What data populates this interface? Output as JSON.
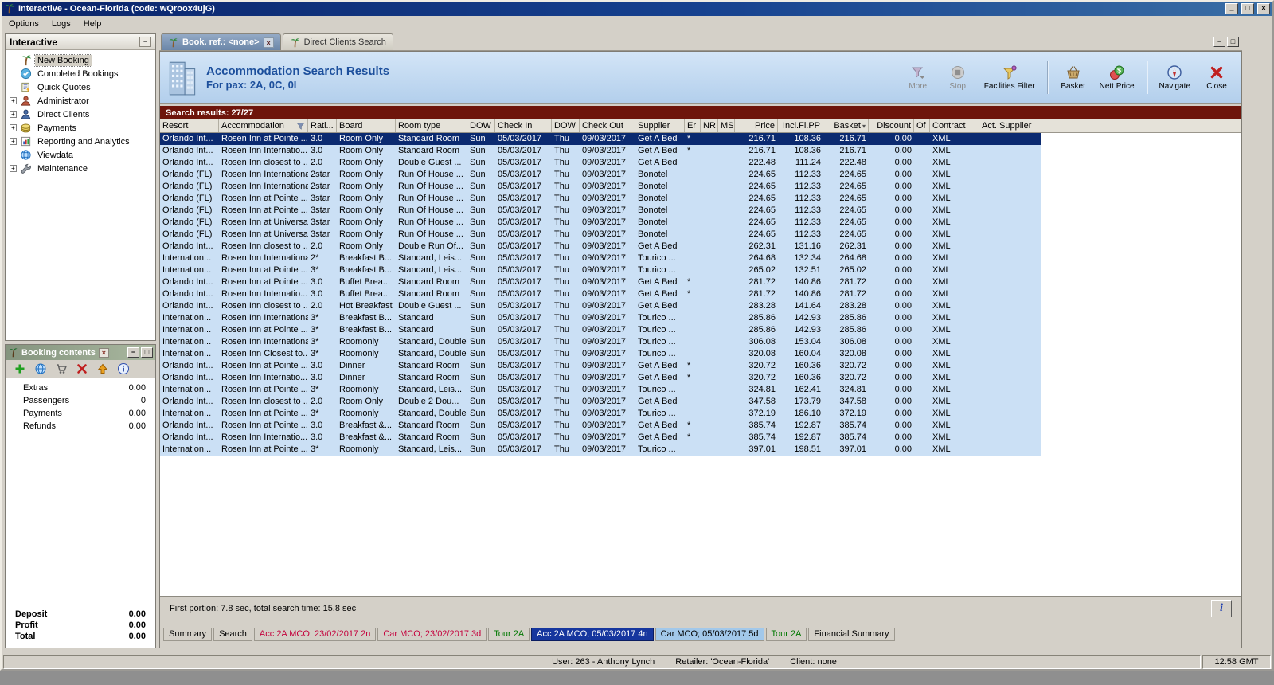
{
  "window": {
    "title": "Interactive - Ocean-Florida (code: wQroox4ujG)",
    "time": "12:58 GMT"
  },
  "icons": {
    "minimize": "_",
    "maximize": "□",
    "close": "×",
    "collapse": "−",
    "expand": "+",
    "tab_close": "×",
    "sort_desc": "▾",
    "info": "i",
    "panel_min": "−",
    "panel_restore": "□"
  },
  "menu": [
    "Options",
    "Logs",
    "Help"
  ],
  "sidebar": {
    "title": "Interactive",
    "items": [
      {
        "label": "New Booking",
        "icon": "new-booking-icon",
        "selected": true,
        "expandable": false
      },
      {
        "label": "Completed Bookings",
        "icon": "completed-bookings-icon",
        "selected": false,
        "expandable": false
      },
      {
        "label": "Quick Quotes",
        "icon": "quick-quotes-icon",
        "selected": false,
        "expandable": false
      },
      {
        "label": "Administrator",
        "icon": "administrator-icon",
        "selected": false,
        "expandable": true
      },
      {
        "label": "Direct Clients",
        "icon": "direct-clients-icon",
        "selected": false,
        "expandable": true
      },
      {
        "label": "Payments",
        "icon": "payments-icon",
        "selected": false,
        "expandable": true
      },
      {
        "label": "Reporting and Analytics",
        "icon": "reporting-icon",
        "selected": false,
        "expandable": true
      },
      {
        "label": "Viewdata",
        "icon": "viewdata-icon",
        "selected": false,
        "expandable": false
      },
      {
        "label": "Maintenance",
        "icon": "maintenance-icon",
        "selected": false,
        "expandable": true
      }
    ]
  },
  "booking_contents": {
    "title": "Booking contents",
    "toolbar_icons": [
      "add-icon",
      "world-icon",
      "basket-small-icon",
      "delete-icon",
      "upload-icon",
      "small-info-icon"
    ],
    "rows": [
      {
        "label": "Extras",
        "value": "0.00"
      },
      {
        "label": "Passengers",
        "value": "0"
      },
      {
        "label": "Payments",
        "value": "0.00"
      },
      {
        "label": "Refunds",
        "value": "0.00"
      }
    ],
    "totals": [
      {
        "label": "Deposit",
        "value": "0.00"
      },
      {
        "label": "Profit",
        "value": "0.00"
      },
      {
        "label": "Total",
        "value": "0.00"
      }
    ]
  },
  "mdi_tabs": [
    {
      "label": "Book. ref.: <none>",
      "active": true,
      "closable": true
    },
    {
      "label": "Direct Clients Search",
      "active": false,
      "closable": false
    }
  ],
  "header": {
    "title": "Accommodation Search Results",
    "subtitle": "For pax: 2A, 0C, 0I"
  },
  "toolbar": [
    {
      "label": "More",
      "icon": "more-icon",
      "disabled": true
    },
    {
      "label": "Stop",
      "icon": "stop-icon",
      "disabled": true
    },
    {
      "label": "Facilities Filter",
      "icon": "facilities-filter-icon",
      "disabled": false
    },
    {
      "separator": true
    },
    {
      "label": "Basket",
      "icon": "basket-icon",
      "disabled": false
    },
    {
      "label": "Nett Price",
      "icon": "nett-price-icon",
      "disabled": false
    },
    {
      "separator": true
    },
    {
      "label": "Navigate",
      "icon": "navigate-icon",
      "disabled": false
    },
    {
      "label": "Close",
      "icon": "close-icon",
      "disabled": false
    }
  ],
  "results_bar": "Search results: 27/27",
  "table": {
    "columns": [
      "Resort",
      "Accommodation",
      "Rati...",
      "Board",
      "Room type",
      "DOW",
      "Check In",
      "DOW",
      "Check Out",
      "Supplier",
      "Er",
      "NR",
      "MS",
      "Price",
      "Incl.Fl.PP",
      "Basket",
      "Discount",
      "Of",
      "Contract",
      "Act. Supplier"
    ],
    "selected_row": 0,
    "rows": [
      [
        "Orlando Int...",
        "Rosen Inn at Pointe ...",
        "3.0",
        "Room Only",
        "Standard Room",
        "Sun",
        "05/03/2017",
        "Thu",
        "09/03/2017",
        "Get A Bed",
        "*",
        "",
        "",
        "216.71",
        "108.36",
        "216.71",
        "0.00",
        "",
        "XML",
        ""
      ],
      [
        "Orlando Int...",
        "Rosen Inn Internatio...",
        "3.0",
        "Room Only",
        "Standard Room",
        "Sun",
        "05/03/2017",
        "Thu",
        "09/03/2017",
        "Get A Bed",
        "*",
        "",
        "",
        "216.71",
        "108.36",
        "216.71",
        "0.00",
        "",
        "XML",
        ""
      ],
      [
        "Orlando Int...",
        "Rosen Inn closest to ...",
        "2.0",
        "Room Only",
        "Double Guest ...",
        "Sun",
        "05/03/2017",
        "Thu",
        "09/03/2017",
        "Get A Bed",
        "",
        "",
        "",
        "222.48",
        "111.24",
        "222.48",
        "0.00",
        "",
        "XML",
        ""
      ],
      [
        "Orlando (FL)",
        "Rosen Inn International",
        "2star",
        "Room Only",
        "Run Of House ...",
        "Sun",
        "05/03/2017",
        "Thu",
        "09/03/2017",
        "Bonotel",
        "",
        "",
        "",
        "224.65",
        "112.33",
        "224.65",
        "0.00",
        "",
        "XML",
        ""
      ],
      [
        "Orlando (FL)",
        "Rosen Inn International",
        "2star",
        "Room Only",
        "Run Of House ...",
        "Sun",
        "05/03/2017",
        "Thu",
        "09/03/2017",
        "Bonotel",
        "",
        "",
        "",
        "224.65",
        "112.33",
        "224.65",
        "0.00",
        "",
        "XML",
        ""
      ],
      [
        "Orlando (FL)",
        "Rosen Inn at Pointe ...",
        "3star",
        "Room Only",
        "Run Of House ...",
        "Sun",
        "05/03/2017",
        "Thu",
        "09/03/2017",
        "Bonotel",
        "",
        "",
        "",
        "224.65",
        "112.33",
        "224.65",
        "0.00",
        "",
        "XML",
        ""
      ],
      [
        "Orlando (FL)",
        "Rosen Inn at Pointe ...",
        "3star",
        "Room Only",
        "Run Of House ...",
        "Sun",
        "05/03/2017",
        "Thu",
        "09/03/2017",
        "Bonotel",
        "",
        "",
        "",
        "224.65",
        "112.33",
        "224.65",
        "0.00",
        "",
        "XML",
        ""
      ],
      [
        "Orlando (FL)",
        "Rosen Inn at Universal",
        "3star",
        "Room Only",
        "Run Of House ...",
        "Sun",
        "05/03/2017",
        "Thu",
        "09/03/2017",
        "Bonotel",
        "",
        "",
        "",
        "224.65",
        "112.33",
        "224.65",
        "0.00",
        "",
        "XML",
        ""
      ],
      [
        "Orlando (FL)",
        "Rosen Inn at Universal",
        "3star",
        "Room Only",
        "Run Of House ...",
        "Sun",
        "05/03/2017",
        "Thu",
        "09/03/2017",
        "Bonotel",
        "",
        "",
        "",
        "224.65",
        "112.33",
        "224.65",
        "0.00",
        "",
        "XML",
        ""
      ],
      [
        "Orlando Int...",
        "Rosen Inn closest to ...",
        "2.0",
        "Room Only",
        "Double Run Of...",
        "Sun",
        "05/03/2017",
        "Thu",
        "09/03/2017",
        "Get A Bed",
        "",
        "",
        "",
        "262.31",
        "131.16",
        "262.31",
        "0.00",
        "",
        "XML",
        ""
      ],
      [
        "Internation...",
        "Rosen Inn International",
        "2*",
        "Breakfast B...",
        "Standard, Leis...",
        "Sun",
        "05/03/2017",
        "Thu",
        "09/03/2017",
        "Tourico ...",
        "",
        "",
        "",
        "264.68",
        "132.34",
        "264.68",
        "0.00",
        "",
        "XML",
        ""
      ],
      [
        "Internation...",
        "Rosen Inn at Pointe ...",
        "3*",
        "Breakfast B...",
        "Standard, Leis...",
        "Sun",
        "05/03/2017",
        "Thu",
        "09/03/2017",
        "Tourico ...",
        "",
        "",
        "",
        "265.02",
        "132.51",
        "265.02",
        "0.00",
        "",
        "XML",
        ""
      ],
      [
        "Orlando Int...",
        "Rosen Inn at Pointe ...",
        "3.0",
        "Buffet Brea...",
        "Standard Room",
        "Sun",
        "05/03/2017",
        "Thu",
        "09/03/2017",
        "Get A Bed",
        "*",
        "",
        "",
        "281.72",
        "140.86",
        "281.72",
        "0.00",
        "",
        "XML",
        ""
      ],
      [
        "Orlando Int...",
        "Rosen Inn Internatio...",
        "3.0",
        "Buffet Brea...",
        "Standard Room",
        "Sun",
        "05/03/2017",
        "Thu",
        "09/03/2017",
        "Get A Bed",
        "*",
        "",
        "",
        "281.72",
        "140.86",
        "281.72",
        "0.00",
        "",
        "XML",
        ""
      ],
      [
        "Orlando Int...",
        "Rosen Inn closest to ...",
        "2.0",
        "Hot Breakfast",
        "Double Guest ...",
        "Sun",
        "05/03/2017",
        "Thu",
        "09/03/2017",
        "Get A Bed",
        "",
        "",
        "",
        "283.28",
        "141.64",
        "283.28",
        "0.00",
        "",
        "XML",
        ""
      ],
      [
        "Internation...",
        "Rosen Inn International",
        "3*",
        "Breakfast B...",
        "Standard",
        "Sun",
        "05/03/2017",
        "Thu",
        "09/03/2017",
        "Tourico ...",
        "",
        "",
        "",
        "285.86",
        "142.93",
        "285.86",
        "0.00",
        "",
        "XML",
        ""
      ],
      [
        "Internation...",
        "Rosen Inn at Pointe ...",
        "3*",
        "Breakfast B...",
        "Standard",
        "Sun",
        "05/03/2017",
        "Thu",
        "09/03/2017",
        "Tourico ...",
        "",
        "",
        "",
        "285.86",
        "142.93",
        "285.86",
        "0.00",
        "",
        "XML",
        ""
      ],
      [
        "Internation...",
        "Rosen Inn International",
        "3*",
        "Roomonly",
        "Standard, Double",
        "Sun",
        "05/03/2017",
        "Thu",
        "09/03/2017",
        "Tourico ...",
        "",
        "",
        "",
        "306.08",
        "153.04",
        "306.08",
        "0.00",
        "",
        "XML",
        ""
      ],
      [
        "Internation...",
        "Rosen Inn Closest to...",
        "3*",
        "Roomonly",
        "Standard, Double",
        "Sun",
        "05/03/2017",
        "Thu",
        "09/03/2017",
        "Tourico ...",
        "",
        "",
        "",
        "320.08",
        "160.04",
        "320.08",
        "0.00",
        "",
        "XML",
        ""
      ],
      [
        "Orlando Int...",
        "Rosen Inn at Pointe ...",
        "3.0",
        "Dinner",
        "Standard Room",
        "Sun",
        "05/03/2017",
        "Thu",
        "09/03/2017",
        "Get A Bed",
        "*",
        "",
        "",
        "320.72",
        "160.36",
        "320.72",
        "0.00",
        "",
        "XML",
        ""
      ],
      [
        "Orlando Int...",
        "Rosen Inn Internatio...",
        "3.0",
        "Dinner",
        "Standard Room",
        "Sun",
        "05/03/2017",
        "Thu",
        "09/03/2017",
        "Get A Bed",
        "*",
        "",
        "",
        "320.72",
        "160.36",
        "320.72",
        "0.00",
        "",
        "XML",
        ""
      ],
      [
        "Internation...",
        "Rosen Inn at Pointe ...",
        "3*",
        "Roomonly",
        "Standard, Leis...",
        "Sun",
        "05/03/2017",
        "Thu",
        "09/03/2017",
        "Tourico ...",
        "",
        "",
        "",
        "324.81",
        "162.41",
        "324.81",
        "0.00",
        "",
        "XML",
        ""
      ],
      [
        "Orlando Int...",
        "Rosen Inn closest to ...",
        "2.0",
        "Room Only",
        "Double 2 Dou...",
        "Sun",
        "05/03/2017",
        "Thu",
        "09/03/2017",
        "Get A Bed",
        "",
        "",
        "",
        "347.58",
        "173.79",
        "347.58",
        "0.00",
        "",
        "XML",
        ""
      ],
      [
        "Internation...",
        "Rosen Inn at Pointe ...",
        "3*",
        "Roomonly",
        "Standard, Double",
        "Sun",
        "05/03/2017",
        "Thu",
        "09/03/2017",
        "Tourico ...",
        "",
        "",
        "",
        "372.19",
        "186.10",
        "372.19",
        "0.00",
        "",
        "XML",
        ""
      ],
      [
        "Orlando Int...",
        "Rosen Inn at Pointe ...",
        "3.0",
        "Breakfast &...",
        "Standard Room",
        "Sun",
        "05/03/2017",
        "Thu",
        "09/03/2017",
        "Get A Bed",
        "*",
        "",
        "",
        "385.74",
        "192.87",
        "385.74",
        "0.00",
        "",
        "XML",
        ""
      ],
      [
        "Orlando Int...",
        "Rosen Inn Internatio...",
        "3.0",
        "Breakfast &...",
        "Standard Room",
        "Sun",
        "05/03/2017",
        "Thu",
        "09/03/2017",
        "Get A Bed",
        "*",
        "",
        "",
        "385.74",
        "192.87",
        "385.74",
        "0.00",
        "",
        "XML",
        ""
      ],
      [
        "Internation...",
        "Rosen Inn at Pointe ...",
        "3*",
        "Roomonly",
        "Standard, Leis...",
        "Sun",
        "05/03/2017",
        "Thu",
        "09/03/2017",
        "Tourico ...",
        "",
        "",
        "",
        "397.01",
        "198.51",
        "397.01",
        "0.00",
        "",
        "XML",
        ""
      ]
    ]
  },
  "status_line": "First portion: 7.8 sec, total search time: 15.8 sec",
  "bottom_tabs": [
    {
      "label": "Summary",
      "style": "default"
    },
    {
      "label": "Search",
      "style": "default"
    },
    {
      "label": "Acc 2A MCO; 23/02/2017 2n",
      "style": "red"
    },
    {
      "label": "Car MCO; 23/02/2017 3d",
      "style": "red"
    },
    {
      "label": "Tour 2A",
      "style": "green"
    },
    {
      "label": "Acc 2A MCO; 05/03/2017 4n",
      "style": "active"
    },
    {
      "label": "Car MCO; 05/03/2017 5d",
      "style": "lightblue"
    },
    {
      "label": "Tour 2A",
      "style": "green"
    },
    {
      "label": "Financial Summary",
      "style": "default"
    }
  ],
  "statusbar": {
    "user": "User: 263 - Anthony Lynch",
    "retailer": "Retailer: 'Ocean-Florida'",
    "client": "Client: none"
  },
  "colors": {
    "selection": "#0b2a70",
    "row": "#cbe0f5",
    "results_bar": "#6e150b",
    "accent_blue": "#1c4f9c"
  }
}
